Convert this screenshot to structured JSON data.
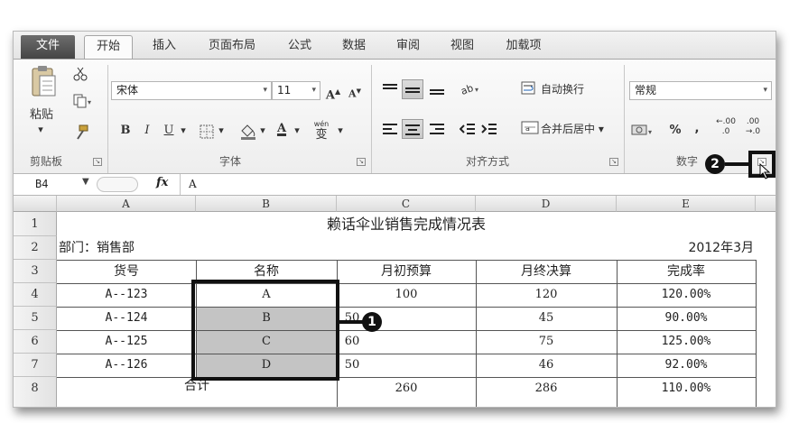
{
  "tabs": [
    "文件",
    "开始",
    "插入",
    "页面布局",
    "公式",
    "数据",
    "审阅",
    "视图",
    "加载项"
  ],
  "ribbon": {
    "clipboard": {
      "paste": "粘贴",
      "label": "剪贴板"
    },
    "font": {
      "name": "宋体",
      "size": "11",
      "grow": "A",
      "shrink": "A",
      "bold": "B",
      "italic": "I",
      "underline": "U",
      "wen": "wén",
      "wen_char": "变",
      "label": "字体"
    },
    "alignment": {
      "wrap_text": "自动换行",
      "merge_center": "合并后居中",
      "label": "对齐方式"
    },
    "number": {
      "format": "常规",
      "percent": "%",
      "comma": ",",
      "inc": ".00",
      "dec": ".00",
      "label": "数字"
    },
    "arrow_text": "←"
  },
  "formula_bar": {
    "cell_ref": "B4",
    "fx": "fx",
    "content": "A"
  },
  "columns": [
    "A",
    "B",
    "C",
    "D",
    "E"
  ],
  "rows": [
    "1",
    "2",
    "3",
    "4",
    "5",
    "6",
    "7",
    "8"
  ],
  "sheet": {
    "title": "赖话伞业销售完成情况表",
    "department": "部门：销售部",
    "date": "2012年3月",
    "headers": [
      "货号",
      "名称",
      "月初预算",
      "月终决算",
      "完成率"
    ],
    "data": [
      [
        "A--123",
        "A",
        "100",
        "120",
        "120.00%"
      ],
      [
        "A--124",
        "B",
        "50",
        "45",
        "90.00%"
      ],
      [
        "A--125",
        "C",
        "60",
        "75",
        "125.00%"
      ],
      [
        "A--126",
        "D",
        "50",
        "46",
        "92.00%"
      ]
    ],
    "total": {
      "label": "合计",
      "budget": "260",
      "final": "286",
      "rate": "110.00%"
    }
  },
  "markers": {
    "one": "1",
    "two": "2"
  }
}
